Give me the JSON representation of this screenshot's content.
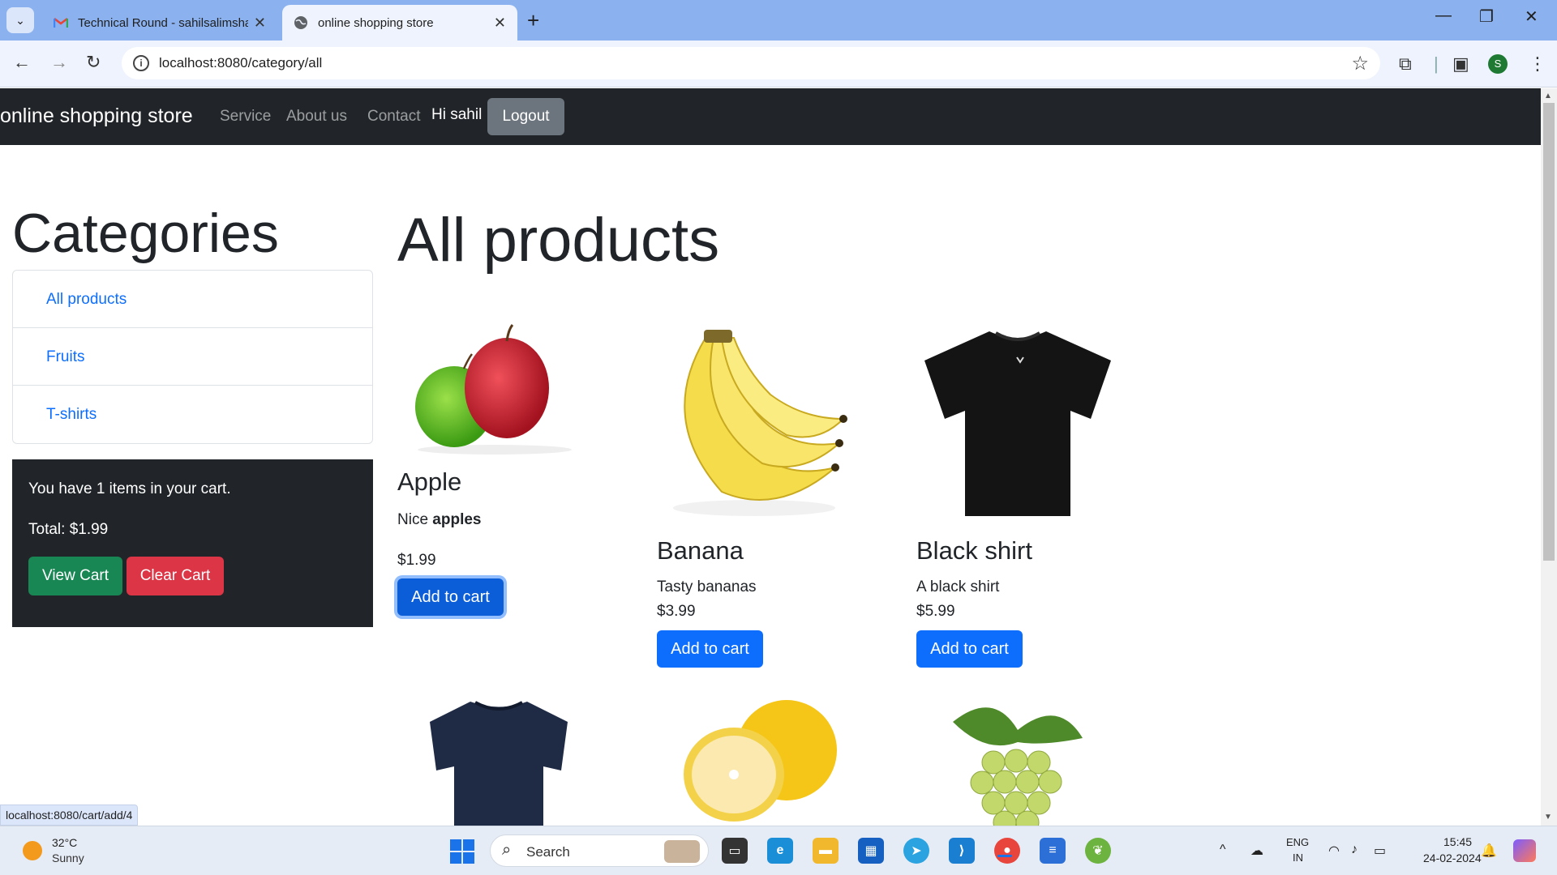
{
  "browser": {
    "tabs": [
      {
        "title": "Technical Round - sahilsalimsha",
        "favicon": "gmail-icon",
        "active": false
      },
      {
        "title": "online shopping store",
        "favicon": "globe-icon",
        "active": true
      }
    ],
    "url": "localhost:8080/category/all",
    "status_url": "localhost:8080/cart/add/4",
    "profile_initial": "S"
  },
  "navbar": {
    "brand": "online shopping store",
    "links": [
      "Service",
      "About us",
      "Contact"
    ],
    "greeting": "Hi sahil",
    "logout_label": "Logout"
  },
  "sidebar": {
    "heading": "Categories",
    "categories": [
      "All products",
      "Fruits",
      "T-shirts"
    ]
  },
  "cart": {
    "summary": "You have 1 items in your cart.",
    "total": "Total: $1.99",
    "view_label": "View Cart",
    "clear_label": "Clear Cart"
  },
  "main": {
    "heading": "All products",
    "products": [
      {
        "name": "Apple",
        "desc_prefix": "Nice ",
        "desc_bold": "apples",
        "price": "$1.99",
        "button": "Add to cart",
        "image": "apple-image"
      },
      {
        "name": "Banana",
        "desc": "Tasty bananas",
        "price": "$3.99",
        "button": "Add to cart",
        "image": "banana-image"
      },
      {
        "name": "Black shirt",
        "desc": "A black shirt",
        "price": "$5.99",
        "button": "Add to cart",
        "image": "black-shirt-image"
      }
    ],
    "second_row_images": [
      "navy-shirt-image",
      "grapefruit-image",
      "grapes-image"
    ]
  },
  "taskbar": {
    "weather_temp": "32°C",
    "weather_cond": "Sunny",
    "search_label": "Search",
    "lang_line1": "ENG",
    "lang_line2": "IN",
    "time": "15:45",
    "date": "24-02-2024"
  },
  "colors": {
    "primary": "#0d6efd",
    "success": "#198754",
    "danger": "#dc3545",
    "secondary": "#6c757d",
    "dark": "#212529"
  }
}
